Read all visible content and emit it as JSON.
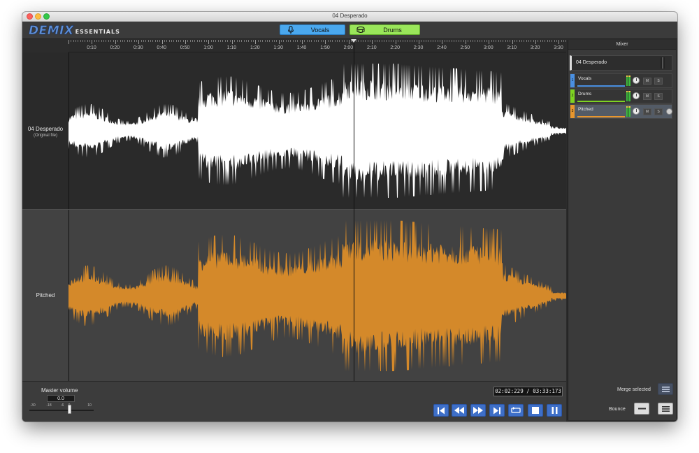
{
  "window": {
    "title": "04 Desperado"
  },
  "logo": {
    "main": "DEMIX",
    "sub": "ESSENTIALS"
  },
  "toolbar": {
    "stems": [
      {
        "label": "Vocals",
        "icon": "microphone-icon",
        "color": "#4aa8ee"
      },
      {
        "label": "Drums",
        "icon": "drum-icon",
        "color": "#9ae65a"
      }
    ]
  },
  "ruler": {
    "labels": [
      "0:10",
      "0:20",
      "0:30",
      "0:40",
      "0:50",
      "1:00",
      "1:10",
      "1:20",
      "1:30",
      "1:40",
      "1:50",
      "2:00",
      "2:10",
      "2:20",
      "2:30",
      "2:40",
      "2:50",
      "3:00",
      "3:10",
      "3:20",
      "3:30"
    ]
  },
  "tracks": {
    "original": {
      "name": "04 Desperado",
      "subtitle": "(Original file)",
      "wave_color": "#ffffff"
    },
    "pitched": {
      "name": "Pitched",
      "wave_color": "#d4892a"
    }
  },
  "mixer": {
    "title": "Mixer",
    "master": {
      "name": "04 Desperado"
    },
    "rows": [
      {
        "num": "1",
        "name": "Vocals",
        "color": "#4a90e2",
        "mute": "M",
        "solo": "S",
        "selected": false
      },
      {
        "num": "2",
        "name": "Drums",
        "color": "#7ed321",
        "mute": "M",
        "solo": "S",
        "selected": false
      },
      {
        "num": "3",
        "name": "Pitched",
        "color": "#e8962d",
        "mute": "M",
        "solo": "S",
        "selected": true
      }
    ],
    "merge_label": "Merge selected",
    "bounce_label": "Bounce"
  },
  "master_volume": {
    "label": "Master volume",
    "value": "0.0",
    "scale": [
      "-30",
      "-18",
      "-6",
      "0",
      "10"
    ]
  },
  "time": {
    "display": "02:02:229 / 03:33:173"
  },
  "transport": [
    {
      "name": "skip-to-start",
      "icon": "skip-back-icon"
    },
    {
      "name": "rewind",
      "icon": "rewind-icon"
    },
    {
      "name": "fast-forward",
      "icon": "fast-forward-icon"
    },
    {
      "name": "skip-to-end",
      "icon": "skip-forward-icon"
    },
    {
      "name": "loop",
      "icon": "loop-icon"
    },
    {
      "name": "stop",
      "icon": "stop-icon"
    },
    {
      "name": "pause",
      "icon": "pause-icon"
    }
  ]
}
